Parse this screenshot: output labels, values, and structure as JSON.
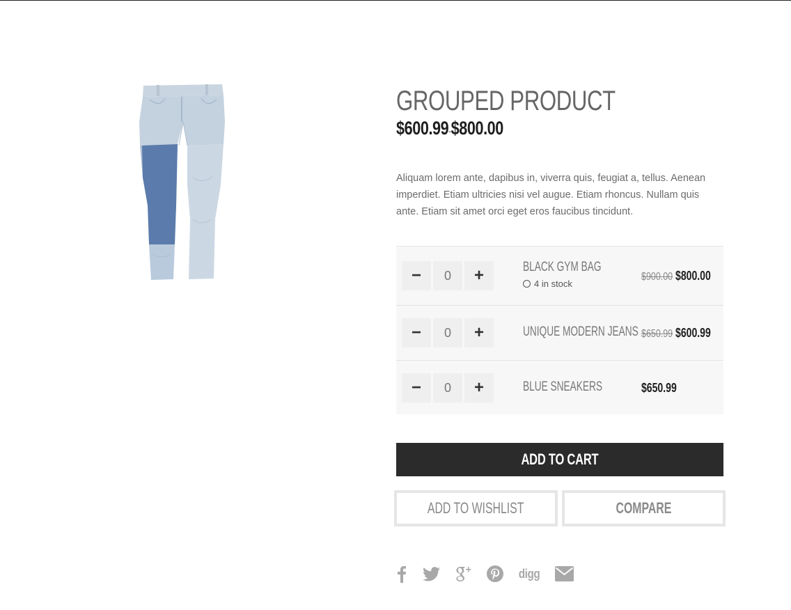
{
  "product": {
    "title": "GROUPED PRODUCT",
    "price_min": "$600.99",
    "price_sep": "-",
    "price_max": "$800.00",
    "description": "Aliquam lorem ante, dapibus in, viverra quis, feugiat a, tellus. Aenean imperdiet. Etiam ultricies nisi vel augue. Etiam rhoncus. Nullam quis ante. Etiam sit amet orci eget eros faucibus tincidunt."
  },
  "grouped_items": [
    {
      "name": "BLACK GYM BAG",
      "qty": "0",
      "stock": "4 in stock",
      "old_price": "$900.00",
      "price": "$800.00"
    },
    {
      "name": "UNIQUE MODERN JEANS",
      "qty": "0",
      "old_price": "$650.99",
      "price": "$600.99"
    },
    {
      "name": "BLUE SNEAKERS",
      "qty": "0",
      "price": "$650.99"
    }
  ],
  "stepper": {
    "minus": "−",
    "plus": "+"
  },
  "actions": {
    "add_to_cart": "ADD TO CART",
    "add_to_wishlist": "ADD TO WISHLIST",
    "compare": "COMPARE"
  },
  "social": {
    "icons": [
      "facebook-icon",
      "twitter-icon",
      "google-plus-icon",
      "pinterest-icon",
      "digg-icon",
      "email-icon"
    ],
    "digg_label": "digg"
  },
  "colors": {
    "primary_button": "#2b2b2b",
    "table_background": "#f7f7f7",
    "icon_gray": "#a8a8a8"
  }
}
